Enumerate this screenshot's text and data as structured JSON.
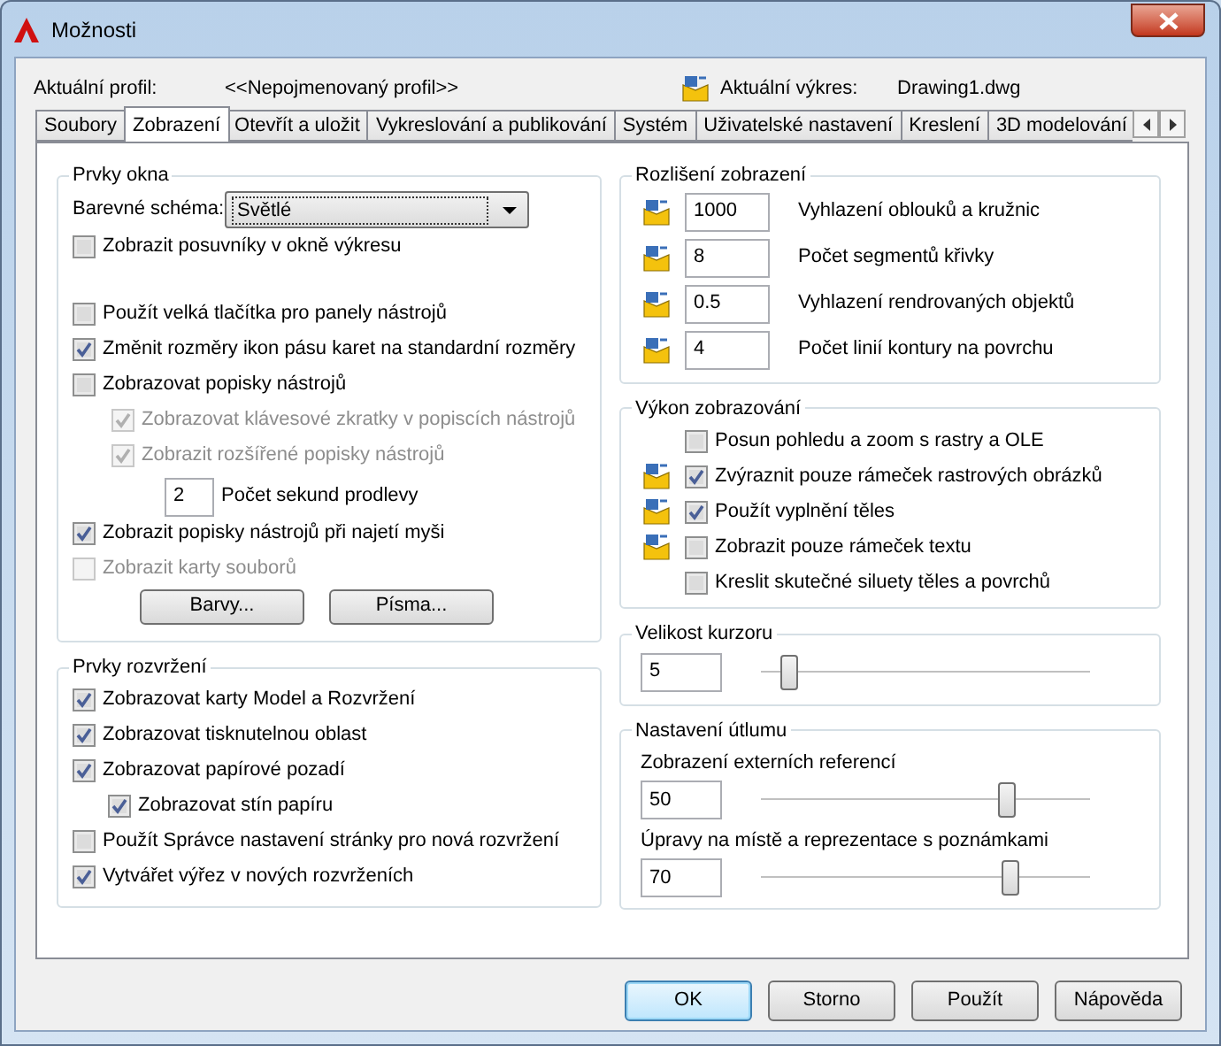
{
  "window": {
    "title": "Možnosti"
  },
  "profile": {
    "label": "Aktuální profil:",
    "value": "<<Nepojmenovaný profil>>"
  },
  "drawing": {
    "label": "Aktuální výkres:",
    "value": "Drawing1.dwg"
  },
  "tabs": [
    {
      "label": "Soubory",
      "selected": false
    },
    {
      "label": "Zobrazení",
      "selected": true
    },
    {
      "label": "Otevřít a uložit",
      "selected": false
    },
    {
      "label": "Vykreslování a publikování",
      "selected": false
    },
    {
      "label": "Systém",
      "selected": false
    },
    {
      "label": "Uživatelské nastavení",
      "selected": false
    },
    {
      "label": "Kreslení",
      "selected": false
    },
    {
      "label": "3D modelování",
      "selected": false
    }
  ],
  "window_elements": {
    "title": "Prvky okna",
    "color_scheme": {
      "label": "Barevné schéma:",
      "value": "Světlé"
    },
    "options": [
      {
        "kind": "checkbox",
        "label": "Zobrazit posuvníky v okně výkresu",
        "checked": false,
        "disabled": false
      },
      {
        "kind": "checkbox",
        "label": "Použít velká tlačítka pro panely nástrojů",
        "checked": false,
        "disabled": false
      },
      {
        "kind": "checkbox",
        "label": "Změnit rozměry ikon pásu karet na standardní rozměry",
        "checked": true,
        "disabled": false
      },
      {
        "kind": "checkbox",
        "label": "Zobrazovat popisky nástrojů",
        "checked": false,
        "disabled": false,
        "children": [
          {
            "kind": "checkbox",
            "label": "Zobrazovat klávesové zkratky v popiscích nástrojů",
            "checked": true,
            "disabled": true
          },
          {
            "kind": "checkbox",
            "label": "Zobrazit rozšířené popisky nástrojů",
            "checked": true,
            "disabled": true
          },
          {
            "kind": "number",
            "value": "2",
            "label": "Počet sekund prodlevy"
          }
        ]
      },
      {
        "kind": "checkbox",
        "label": "Zobrazit popisky nástrojů při najetí myši",
        "checked": true,
        "disabled": false
      },
      {
        "kind": "checkbox",
        "label": "Zobrazit karty souborů",
        "checked": false,
        "disabled": true
      }
    ],
    "buttons": [
      "Barvy...",
      "Písma..."
    ]
  },
  "layout_elements": {
    "title": "Prvky rozvržení",
    "options": [
      {
        "label": "Zobrazovat karty Model a Rozvržení",
        "checked": true
      },
      {
        "label": "Zobrazovat tisknutelnou oblast",
        "checked": true
      },
      {
        "label": "Zobrazovat papírové pozadí",
        "checked": true,
        "children": [
          {
            "label": "Zobrazovat stín papíru",
            "checked": true
          }
        ]
      },
      {
        "label": "Použít Správce nastavení stránky pro nová rozvržení",
        "checked": false
      },
      {
        "label": "Vytvářet výřez v nových rozvrženích",
        "checked": true
      }
    ]
  },
  "display_resolution": {
    "title": "Rozlišení zobrazení",
    "rows": [
      {
        "value": "1000",
        "label": "Vyhlazení oblouků a kružnic",
        "saved_in_drawing": true
      },
      {
        "value": "8",
        "label": "Počet segmentů křivky",
        "saved_in_drawing": true
      },
      {
        "value": "0.5",
        "label": "Vyhlazení rendrovaných objektů",
        "saved_in_drawing": true
      },
      {
        "value": "4",
        "label": "Počet linií kontury na povrchu",
        "saved_in_drawing": true
      }
    ]
  },
  "display_performance": {
    "title": "Výkon zobrazování",
    "rows": [
      {
        "label": "Posun pohledu a zoom s rastry a OLE",
        "checked": false,
        "saved_in_drawing": false
      },
      {
        "label": "Zvýraznit pouze rámeček rastrových obrázků",
        "checked": true,
        "saved_in_drawing": true
      },
      {
        "label": "Použít vyplnění těles",
        "checked": true,
        "saved_in_drawing": true
      },
      {
        "label": "Zobrazit pouze rámeček textu",
        "checked": false,
        "saved_in_drawing": true
      },
      {
        "label": "Kreslit skutečné siluety těles a povrchů",
        "checked": false,
        "saved_in_drawing": false
      }
    ]
  },
  "crosshair_size": {
    "title": "Velikost kurzoru",
    "value": "5",
    "level": 0.06
  },
  "fade_control": {
    "title": "Nastavení útlumu",
    "sliders": [
      {
        "label": "Zobrazení externích referencí",
        "value": "50",
        "level": 0.76
      },
      {
        "label": "Úpravy na místě a reprezentace s poznámkami",
        "value": "70",
        "level": 0.77
      }
    ]
  },
  "buttons": [
    {
      "label": "OK",
      "default": true
    },
    {
      "label": "Storno",
      "default": false
    },
    {
      "label": "Použít",
      "default": false
    },
    {
      "label": "Nápověda",
      "default": false
    }
  ]
}
